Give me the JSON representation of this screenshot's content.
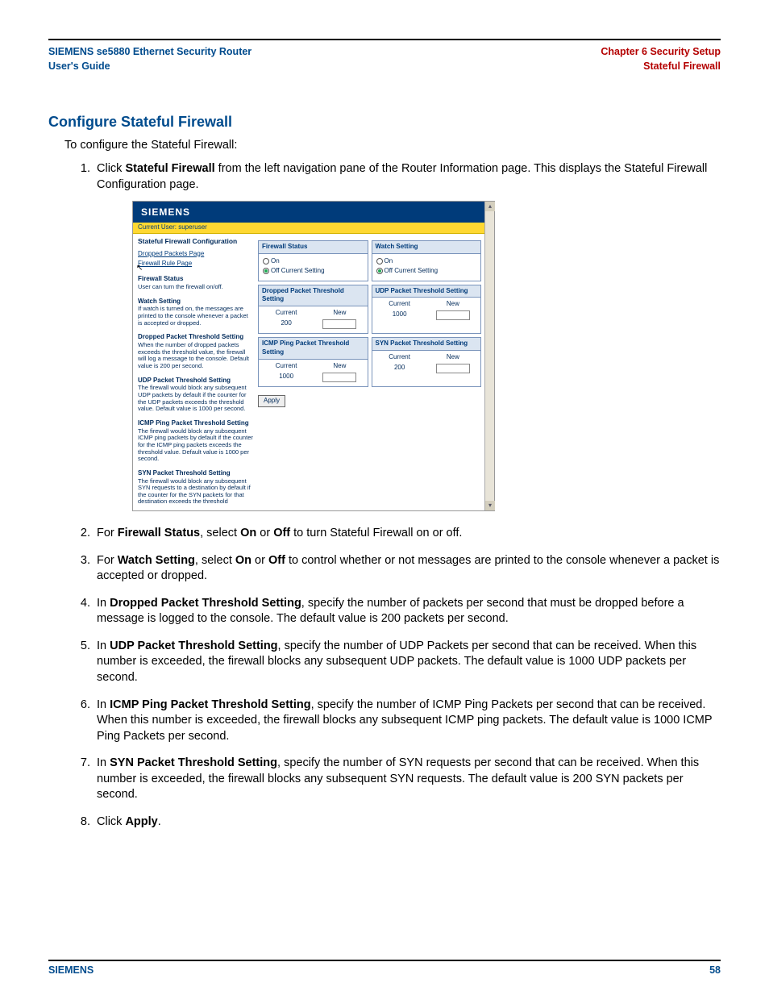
{
  "header": {
    "left_line1": "SIEMENS se5880 Ethernet Security Router",
    "left_line2": "User's Guide",
    "right_line1": "Chapter 6  Security Setup",
    "right_line2": "Stateful Firewall"
  },
  "section_title": "Configure Stateful Firewall",
  "intro": "To configure the Stateful Firewall:",
  "steps": {
    "s1a": "Click ",
    "s1b": "Stateful Firewall",
    "s1c": " from the left navigation pane of the Router Information page. This displays the Stateful Firewall Configuration page.",
    "s2a": "For ",
    "s2b": "Firewall Status",
    "s2c": ", select ",
    "s2d": "On",
    "s2e": " or ",
    "s2f": "Off",
    "s2g": " to turn Stateful Firewall on or off.",
    "s3a": "For ",
    "s3b": "Watch Setting",
    "s3c": ", select ",
    "s3d": "On",
    "s3e": " or ",
    "s3f": "Off",
    "s3g": " to control whether or not messages are printed to the console whenever a packet is accepted or dropped.",
    "s4a": "In ",
    "s4b": "Dropped Packet Threshold Setting",
    "s4c": ", specify the number of packets per second that must be dropped before a message is logged to the console. The default value is 200 packets per second.",
    "s5a": "In ",
    "s5b": "UDP Packet Threshold Setting",
    "s5c": ", specify the number of UDP Packets per second that can be received. When this number is exceeded, the firewall blocks any subsequent UDP packets. The default value is 1000 UDP packets per second.",
    "s6a": "In ",
    "s6b": "ICMP Ping Packet Threshold Setting",
    "s6c": ", specify the number of ICMP Ping Packets per second that can be received. When this number is exceeded, the firewall blocks any subsequent ICMP ping packets. The default value is 1000 ICMP Ping Packets per second.",
    "s7a": "In ",
    "s7b": "SYN Packet Threshold Setting",
    "s7c": ", specify the number of SYN requests per second that can be received. When this number is exceeded, the firewall blocks any subsequent SYN requests. The default value is 200 SYN packets per second.",
    "s8a": "Click ",
    "s8b": "Apply",
    "s8c": "."
  },
  "shot": {
    "brand": "SIEMENS",
    "userbar": "Current User: superuser",
    "left": {
      "title": "Stateful Firewall Configuration",
      "link1": "Dropped Packets Page",
      "link2": "Firewall Rule Page",
      "sec1_h": "Firewall Status",
      "sec1_t": "User can turn the firewall on/off.",
      "sec2_h": "Watch Setting",
      "sec2_t": "If watch is turned on, the messages are printed to the console whenever a packet is accepted or dropped.",
      "sec3_h": "Dropped Packet Threshold Setting",
      "sec3_t": "When the number of dropped packets exceeds the threshold value, the firewall will log a message to the console. Default value is 200 per second.",
      "sec4_h": "UDP Packet Threshold Setting",
      "sec4_t": "The firewall would block any subsequent UDP packets by default if the counter for the UDP packets exceeds the threshold value. Default value is 1000 per second.",
      "sec5_h": "ICMP Ping Packet Threshold Setting",
      "sec5_t": "The firewall would block any subsequent ICMP ping packets by default if the counter for the ICMP ping packets exceeds the threshold value. Default value is 1000 per second.",
      "sec6_h": "SYN Packet Threshold Setting",
      "sec6_t": "The firewall would block any subsequent SYN requests to a destination by default if the counter for the SYN packets for that destination exceeds the threshold"
    },
    "panels": {
      "fw_status": "Firewall Status",
      "watch": "Watch Setting",
      "on": "On",
      "off_cur": "Off  Current Setting",
      "drop": "Dropped Packet Threshold Setting",
      "udp": "UDP Packet Threshold Setting",
      "icmp": "ICMP Ping Packet Threshold Setting",
      "syn": "SYN Packet Threshold Setting",
      "current": "Current",
      "new": "New",
      "v200": "200",
      "v1000": "1000",
      "apply": "Apply"
    }
  },
  "footer": {
    "left": "SIEMENS",
    "right": "58"
  }
}
